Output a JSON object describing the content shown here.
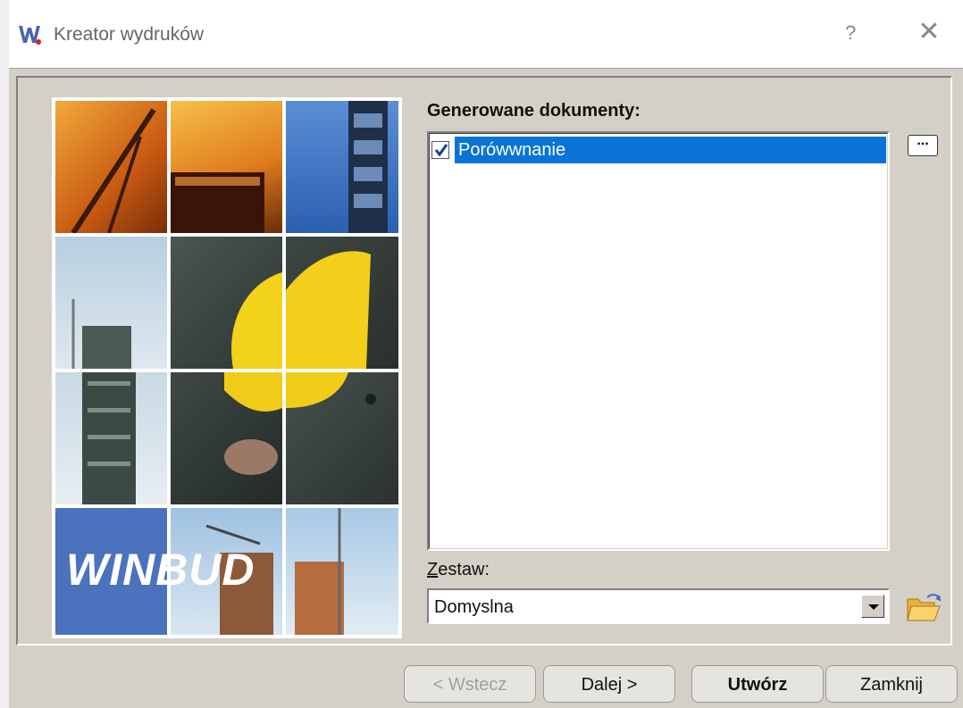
{
  "window": {
    "title": "Kreator wydruków",
    "help_label": "?",
    "close_label": "✕"
  },
  "generated_docs": {
    "label": "Generowane dokumenty:",
    "items": [
      {
        "label": "Porówwnanie",
        "checked": true,
        "selected": true
      }
    ],
    "more_label": "..."
  },
  "set": {
    "label": "Zestaw:",
    "value": "Domyslna"
  },
  "image": {
    "logo_text": "WINBUD"
  },
  "buttons": {
    "back": "< Wstecz",
    "next": "Dalej >",
    "create": "Utwórz",
    "close": "Zamknij"
  }
}
